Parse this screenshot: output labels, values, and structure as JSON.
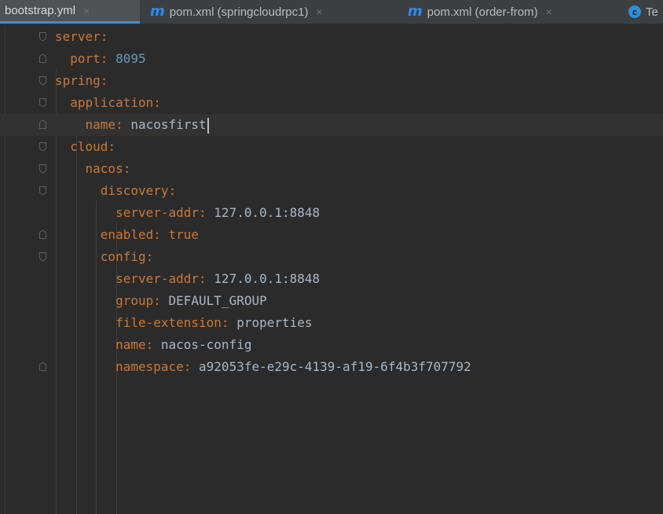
{
  "tabs": [
    {
      "label": "bootstrap.yml",
      "icon": "yaml-file-icon",
      "active": true
    },
    {
      "label": "pom.xml (springcloudrpc1)",
      "icon": "maven-m-icon",
      "active": false
    },
    {
      "label": "pom.xml (order-from)",
      "icon": "maven-m-icon",
      "active": false
    },
    {
      "label": "Te",
      "icon": "class-c-icon",
      "active": false
    }
  ],
  "close_glyph": "×",
  "maven_glyph": "m",
  "class_glyph": "c",
  "editor": {
    "lines": [
      {
        "key": "server",
        "value": ""
      },
      {
        "key": "port",
        "value": "8095"
      },
      {
        "key": "spring",
        "value": ""
      },
      {
        "key": "application",
        "value": ""
      },
      {
        "key": "name",
        "value": "nacosfirst"
      },
      {
        "key": "cloud",
        "value": ""
      },
      {
        "key": "nacos",
        "value": ""
      },
      {
        "key": "discovery",
        "value": ""
      },
      {
        "key": "server-addr",
        "value": "127.0.0.1:8848"
      },
      {
        "key": "enabled",
        "value": "true"
      },
      {
        "key": "config",
        "value": ""
      },
      {
        "key": "server-addr",
        "value": "127.0.0.1:8848"
      },
      {
        "key": "group",
        "value": "DEFAULT_GROUP"
      },
      {
        "key": "file-extension",
        "value": "properties"
      },
      {
        "key": "name",
        "value": "nacos-config"
      },
      {
        "key": "namespace",
        "value": "a92053fe-e29c-4139-af19-6f4b3f707792"
      }
    ]
  },
  "colors": {
    "key": "#cc7832",
    "number": "#6897bb",
    "value": "#a9b7c6",
    "background": "#2b2b2b"
  }
}
